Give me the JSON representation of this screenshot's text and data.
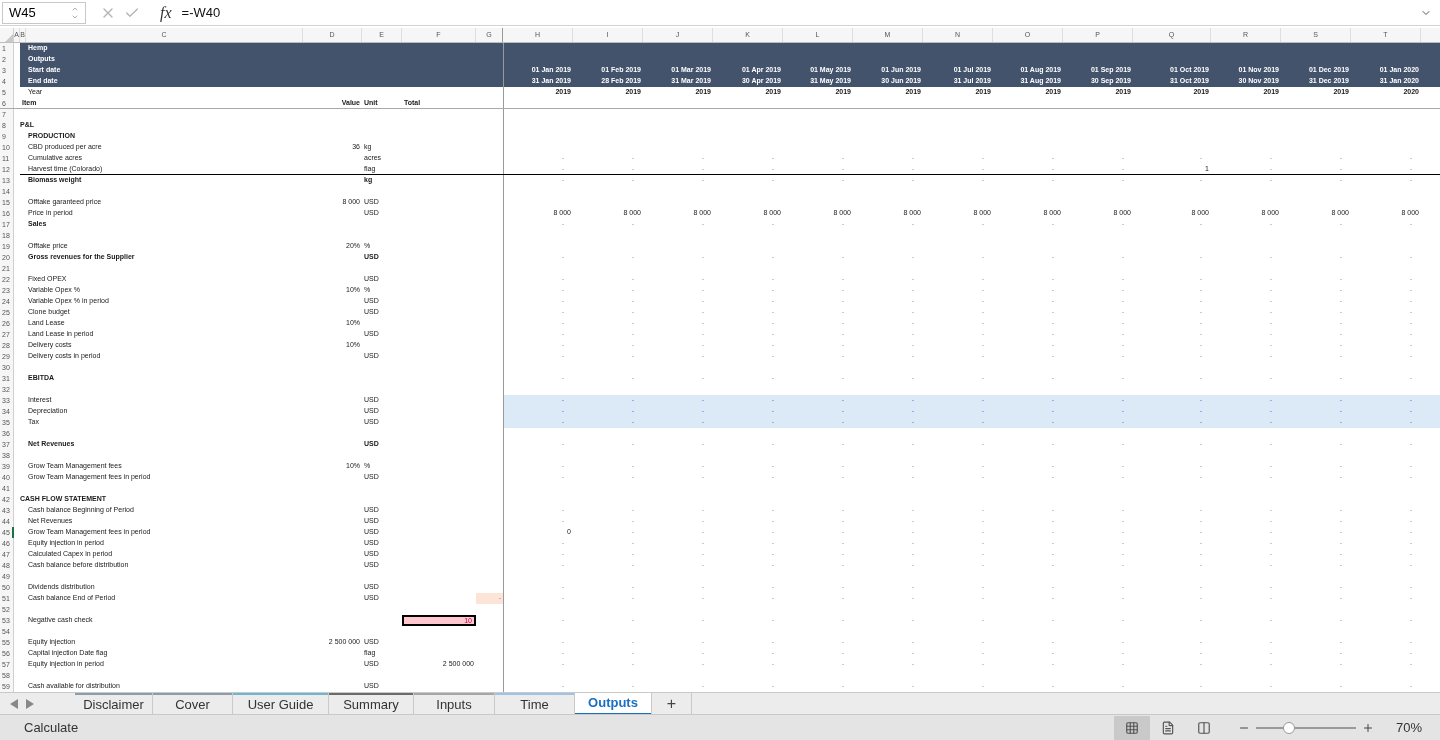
{
  "formula_bar": {
    "name_box": "W45",
    "function_label": "fx",
    "formula": "=-W40"
  },
  "columns": [
    "A",
    "B",
    "C",
    "D",
    "E",
    "F",
    "G",
    "H",
    "I",
    "J",
    "K",
    "L",
    "M",
    "N",
    "O",
    "P",
    "Q",
    "R",
    "S",
    "T"
  ],
  "rows": [
    {
      "n": "1",
      "kind": "banner",
      "label": "Hemp",
      "selected": false
    },
    {
      "n": "2",
      "kind": "banner",
      "label": "Outputs",
      "selected": false
    },
    {
      "n": "3",
      "kind": "banner",
      "label": "Start date",
      "selected": false,
      "months": [
        "01 Jan 2019",
        "01 Feb 2019",
        "01 Mar 2019",
        "01 Apr 2019",
        "01 May 2019",
        "01 Jun 2019",
        "01 Jul 2019",
        "01 Aug 2019",
        "01 Sep 2019",
        "01 Oct 2019",
        "01 Nov 2019",
        "01 Dec 2019",
        "01 Jan 2020"
      ]
    },
    {
      "n": "4",
      "kind": "banner",
      "label": "End date",
      "selected": false,
      "months": [
        "31 Jan 2019",
        "28 Feb 2019",
        "31 Mar 2019",
        "30 Apr 2019",
        "31 May 2019",
        "30 Jun 2019",
        "31 Jul 2019",
        "31 Aug 2019",
        "30 Sep 2019",
        "31 Oct 2019",
        "30 Nov 2019",
        "31 Dec 2019",
        "31 Jan 2020"
      ]
    },
    {
      "n": "5",
      "kind": "year",
      "label": "Year",
      "selected": false,
      "months": [
        "2019",
        "2019",
        "2019",
        "2019",
        "2019",
        "2019",
        "2019",
        "2019",
        "2019",
        "2019",
        "2019",
        "2019",
        "2020"
      ]
    },
    {
      "n": "6",
      "kind": "header",
      "label": "Item",
      "value": "Value",
      "unit": "Unit",
      "total": "Total",
      "selected": false
    },
    {
      "n": "7",
      "kind": "blank",
      "selected": false
    },
    {
      "n": "8",
      "kind": "section",
      "label": "P&L",
      "selected": false
    },
    {
      "n": "9",
      "kind": "bold",
      "label": "PRODUCTION",
      "selected": false
    },
    {
      "n": "10",
      "kind": "plain",
      "label": "CBD produced per acre",
      "value": "36",
      "unit": "kg",
      "selected": false
    },
    {
      "n": "11",
      "kind": "plain",
      "label": "Cumulative acres",
      "unit": "acres",
      "selected": false,
      "months": [
        "-",
        "-",
        "-",
        "-",
        "-",
        "-",
        "-",
        "-",
        "-",
        "-",
        "-",
        "-",
        "-"
      ]
    },
    {
      "n": "12",
      "kind": "plain",
      "label": "Harvest time (Colorado)",
      "unit": "flag",
      "selected": false,
      "border_below": true,
      "months": [
        "-",
        "-",
        "-",
        "-",
        "-",
        "-",
        "-",
        "-",
        "-",
        "1",
        "-",
        "-",
        "-"
      ]
    },
    {
      "n": "13",
      "kind": "bold",
      "label": "Biomass weight",
      "unit": "kg",
      "selected": false,
      "months": [
        "-",
        "-",
        "-",
        "-",
        "-",
        "-",
        "-",
        "-",
        "-",
        "-",
        "-",
        "-",
        "-"
      ]
    },
    {
      "n": "14",
      "kind": "blank",
      "selected": false
    },
    {
      "n": "15",
      "kind": "plain",
      "label": "Offtake garanteed price",
      "value": "8 000",
      "unit": "USD",
      "selected": false
    },
    {
      "n": "16",
      "kind": "plain",
      "label": "Price in period",
      "unit": "USD",
      "selected": false,
      "months": [
        "8 000",
        "8 000",
        "8 000",
        "8 000",
        "8 000",
        "8 000",
        "8 000",
        "8 000",
        "8 000",
        "8 000",
        "8 000",
        "8 000",
        "8 000"
      ]
    },
    {
      "n": "17",
      "kind": "bold",
      "label": "Sales",
      "selected": false,
      "months": [
        "-",
        "-",
        "-",
        "-",
        "-",
        "-",
        "-",
        "-",
        "-",
        "-",
        "-",
        "-",
        "-"
      ]
    },
    {
      "n": "18",
      "kind": "blank",
      "selected": false
    },
    {
      "n": "19",
      "kind": "plain",
      "label": "Offtake price",
      "value": "20%",
      "unit": "%",
      "selected": false
    },
    {
      "n": "20",
      "kind": "bold",
      "label": "Gross revenues for the Supplier",
      "unit": "USD",
      "selected": false,
      "months": [
        "-",
        "-",
        "-",
        "-",
        "-",
        "-",
        "-",
        "-",
        "-",
        "-",
        "-",
        "-",
        "-"
      ]
    },
    {
      "n": "21",
      "kind": "blank",
      "selected": false
    },
    {
      "n": "22",
      "kind": "plain",
      "label": "Fixed OPEX",
      "unit": "USD",
      "selected": false,
      "months": [
        "-",
        "-",
        "-",
        "-",
        "-",
        "-",
        "-",
        "-",
        "-",
        "-",
        "-",
        "-",
        "-"
      ]
    },
    {
      "n": "23",
      "kind": "plain",
      "label": "Variable Opex %",
      "value": "10%",
      "unit": "%",
      "selected": false,
      "months": [
        "-",
        "-",
        "-",
        "-",
        "-",
        "-",
        "-",
        "-",
        "-",
        "-",
        "-",
        "-",
        "-"
      ]
    },
    {
      "n": "24",
      "kind": "plain",
      "label": "Variable Opex % in period",
      "unit": "USD",
      "selected": false,
      "months": [
        "-",
        "-",
        "-",
        "-",
        "-",
        "-",
        "-",
        "-",
        "-",
        "-",
        "-",
        "-",
        "-"
      ]
    },
    {
      "n": "25",
      "kind": "plain",
      "label": "Clone budget",
      "unit": "USD",
      "selected": false,
      "months": [
        "-",
        "-",
        "-",
        "-",
        "-",
        "-",
        "-",
        "-",
        "-",
        "-",
        "-",
        "-",
        "-"
      ]
    },
    {
      "n": "26",
      "kind": "plain",
      "label": "Land Lease",
      "value": "10%",
      "selected": false,
      "months": [
        "-",
        "-",
        "-",
        "-",
        "-",
        "-",
        "-",
        "-",
        "-",
        "-",
        "-",
        "-",
        "-"
      ]
    },
    {
      "n": "27",
      "kind": "plain",
      "label": "Land Lease in period",
      "unit": "USD",
      "selected": false,
      "months": [
        "-",
        "-",
        "-",
        "-",
        "-",
        "-",
        "-",
        "-",
        "-",
        "-",
        "-",
        "-",
        "-"
      ]
    },
    {
      "n": "28",
      "kind": "plain",
      "label": "Delivery costs",
      "value": "10%",
      "selected": false,
      "months": [
        "-",
        "-",
        "-",
        "-",
        "-",
        "-",
        "-",
        "-",
        "-",
        "-",
        "-",
        "-",
        "-"
      ]
    },
    {
      "n": "29",
      "kind": "plain",
      "label": "Delivery costs in period",
      "unit": "USD",
      "selected": false,
      "months": [
        "-",
        "-",
        "-",
        "-",
        "-",
        "-",
        "-",
        "-",
        "-",
        "-",
        "-",
        "-",
        "-"
      ]
    },
    {
      "n": "30",
      "kind": "blank",
      "selected": false
    },
    {
      "n": "31",
      "kind": "bold",
      "label": "EBITDA",
      "selected": false,
      "months": [
        "-",
        "-",
        "-",
        "-",
        "-",
        "-",
        "-",
        "-",
        "-",
        "-",
        "-",
        "-",
        "-"
      ]
    },
    {
      "n": "32",
      "kind": "blank",
      "selected": false
    },
    {
      "n": "33",
      "kind": "plain",
      "label": "Interest",
      "unit": "USD",
      "selected": false,
      "highlighted": true,
      "months": [
        "-",
        "-",
        "-",
        "-",
        "-",
        "-",
        "-",
        "-",
        "-",
        "-",
        "-",
        "-",
        "-"
      ]
    },
    {
      "n": "34",
      "kind": "plain",
      "label": "Depreciation",
      "unit": "USD",
      "selected": false,
      "highlighted": true,
      "months": [
        "-",
        "-",
        "-",
        "-",
        "-",
        "-",
        "-",
        "-",
        "-",
        "-",
        "-",
        "-",
        "-"
      ]
    },
    {
      "n": "35",
      "kind": "plain",
      "label": "Tax",
      "unit": "USD",
      "selected": false,
      "highlighted": true,
      "months": [
        "-",
        "-",
        "-",
        "-",
        "-",
        "-",
        "-",
        "-",
        "-",
        "-",
        "-",
        "-",
        "-"
      ]
    },
    {
      "n": "36",
      "kind": "blank",
      "selected": false
    },
    {
      "n": "37",
      "kind": "bold",
      "label": "Net Revenues",
      "unit": "USD",
      "selected": false,
      "months": [
        "-",
        "-",
        "-",
        "-",
        "-",
        "-",
        "-",
        "-",
        "-",
        "-",
        "-",
        "-",
        "-"
      ]
    },
    {
      "n": "38",
      "kind": "blank",
      "selected": false
    },
    {
      "n": "39",
      "kind": "plain",
      "label": "Grow Team Management fees",
      "value": "10%",
      "unit": "%",
      "selected": false,
      "months": [
        "-",
        "-",
        "-",
        "-",
        "-",
        "-",
        "-",
        "-",
        "-",
        "-",
        "-",
        "-",
        "-"
      ]
    },
    {
      "n": "40",
      "kind": "plain",
      "label": "Grow Team Management fees in period",
      "unit": "USD",
      "selected": false,
      "months": [
        "-",
        "-",
        "-",
        "-",
        "-",
        "-",
        "-",
        "-",
        "-",
        "-",
        "-",
        "-",
        "-"
      ]
    },
    {
      "n": "41",
      "kind": "blank",
      "selected": false
    },
    {
      "n": "42",
      "kind": "section",
      "label": "CASH FLOW STATEMENT",
      "selected": false
    },
    {
      "n": "43",
      "kind": "plain",
      "label": "Cash balance Beginning of Period",
      "unit": "USD",
      "selected": false,
      "months": [
        "-",
        "-",
        "-",
        "-",
        "-",
        "-",
        "-",
        "-",
        "-",
        "-",
        "-",
        "-",
        "-"
      ]
    },
    {
      "n": "44",
      "kind": "plain",
      "label": "Net Revenues",
      "unit": "USD",
      "selected": false,
      "months": [
        "-",
        "-",
        "-",
        "-",
        "-",
        "-",
        "-",
        "-",
        "-",
        "-",
        "-",
        "-",
        "-"
      ]
    },
    {
      "n": "45",
      "kind": "plain",
      "label": "Grow Team Management fees in period",
      "unit": "USD",
      "selected": true,
      "months": [
        "0",
        "-",
        "-",
        "-",
        "-",
        "-",
        "-",
        "-",
        "-",
        "-",
        "-",
        "-",
        "-"
      ]
    },
    {
      "n": "46",
      "kind": "plain",
      "label": "Equity injection in period",
      "unit": "USD",
      "selected": false,
      "months": [
        "-",
        "-",
        "-",
        "-",
        "-",
        "-",
        "-",
        "-",
        "-",
        "-",
        "-",
        "-",
        "-"
      ]
    },
    {
      "n": "47",
      "kind": "plain",
      "label": "Calculated Capex in period",
      "unit": "USD",
      "selected": false,
      "months": [
        "-",
        "-",
        "-",
        "-",
        "-",
        "-",
        "-",
        "-",
        "-",
        "-",
        "-",
        "-",
        "-"
      ]
    },
    {
      "n": "48",
      "kind": "plain",
      "label": "Cash balance before distribution",
      "unit": "USD",
      "selected": false,
      "months": [
        "-",
        "-",
        "-",
        "-",
        "-",
        "-",
        "-",
        "-",
        "-",
        "-",
        "-",
        "-",
        "-"
      ]
    },
    {
      "n": "49",
      "kind": "blank",
      "selected": false
    },
    {
      "n": "50",
      "kind": "plain",
      "label": "Dividends distribution",
      "unit": "USD",
      "selected": false,
      "months": [
        "-",
        "-",
        "-",
        "-",
        "-",
        "-",
        "-",
        "-",
        "-",
        "-",
        "-",
        "-",
        "-"
      ]
    },
    {
      "n": "51",
      "kind": "plain",
      "label": "Cash balance End of Period",
      "unit": "USD",
      "g": "-",
      "g_warning": true,
      "selected": false,
      "months": [
        "-",
        "-",
        "-",
        "-",
        "-",
        "-",
        "-",
        "-",
        "-",
        "-",
        "-",
        "-",
        "-"
      ]
    },
    {
      "n": "52",
      "kind": "blank",
      "selected": false
    },
    {
      "n": "53",
      "kind": "plain",
      "label": "Negative cash check",
      "total": "10",
      "total_alert": true,
      "selected": false,
      "months": [
        "-",
        "-",
        "-",
        "-",
        "-",
        "-",
        "-",
        "-",
        "-",
        "-",
        "-",
        "-",
        "-"
      ]
    },
    {
      "n": "54",
      "kind": "blank",
      "selected": false
    },
    {
      "n": "55",
      "kind": "plain",
      "label": "Equity injection",
      "value": "2 500 000",
      "unit": "USD",
      "selected": false,
      "months": [
        "-",
        "-",
        "-",
        "-",
        "-",
        "-",
        "-",
        "-",
        "-",
        "-",
        "-",
        "-",
        "-"
      ]
    },
    {
      "n": "56",
      "kind": "plain",
      "label": "Capital injection Date flag",
      "unit": "flag",
      "selected": false,
      "months": [
        "-",
        "-",
        "-",
        "-",
        "-",
        "-",
        "-",
        "-",
        "-",
        "-",
        "-",
        "-",
        "-"
      ]
    },
    {
      "n": "57",
      "kind": "plain",
      "label": "Equity injection in period",
      "unit": "USD",
      "total": "2 500 000",
      "selected": false,
      "months": [
        "-",
        "-",
        "-",
        "-",
        "-",
        "-",
        "-",
        "-",
        "-",
        "-",
        "-",
        "-",
        "-"
      ]
    },
    {
      "n": "58",
      "kind": "blank",
      "selected": false
    },
    {
      "n": "59",
      "kind": "plain",
      "label": "Cash available for distribution",
      "unit": "USD",
      "selected": false,
      "months": [
        "-",
        "-",
        "-",
        "-",
        "-",
        "-",
        "-",
        "-",
        "-",
        "-",
        "-",
        "-",
        "-"
      ]
    }
  ],
  "sheet_tabs": [
    {
      "label": "Disclaimer",
      "color": "#8e9bad",
      "selected": false
    },
    {
      "label": "Cover",
      "color": "#8e9bad",
      "selected": false
    },
    {
      "label": "User Guide",
      "color": "#6fb7cc",
      "selected": false
    },
    {
      "label": "Summary",
      "color": "#6b6b6b",
      "selected": false
    },
    {
      "label": "Inputs",
      "color": "#a6a6a6",
      "selected": false
    },
    {
      "label": "Time",
      "color": "#9dc3e6",
      "selected": false
    },
    {
      "label": "Outputs",
      "selected": true
    }
  ],
  "add_tab": "+",
  "status_bar": {
    "text": "Calculate",
    "views": [
      {
        "selected": true
      },
      {
        "selected": false
      },
      {
        "selected": false
      }
    ],
    "zoom": {
      "level": 0.33,
      "label": "70%"
    }
  }
}
